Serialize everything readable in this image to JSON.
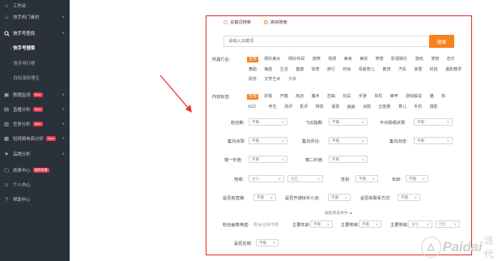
{
  "sidebar": {
    "items": [
      {
        "icon": "home-icon",
        "label": "工作台"
      },
      {
        "icon": "fire-icon",
        "label": "快手热门素材",
        "caret": "∨"
      },
      {
        "icon": "search-icon",
        "label": "快手号查找",
        "caret": "∧"
      },
      {
        "label": "· 快手号搜索"
      },
      {
        "label": "· 快手排行榜"
      },
      {
        "label": "· 目标涨粉博主"
      },
      {
        "icon": "monitor-icon",
        "label": "数据监测",
        "badge": "New",
        "caret": "∨"
      },
      {
        "icon": "live-icon",
        "label": "直播分析",
        "badge": "New",
        "caret": "∨"
      },
      {
        "icon": "task-icon",
        "label": "任务分析",
        "badge": "New",
        "caret": "∨"
      },
      {
        "icon": "video-icon",
        "label": "短视频电商分析",
        "badge": "New",
        "caret": "∨"
      },
      {
        "icon": "heart-icon",
        "label": "品牌分析",
        "caret": "∨"
      },
      {
        "icon": "member-icon",
        "label": "续费中心",
        "badge": "限时特惠"
      },
      {
        "icon": "user-icon",
        "label": "个人中心"
      },
      {
        "icon": "help-icon",
        "label": "帮助中心"
      }
    ]
  },
  "search": {
    "mode_keyword": "关键词搜索",
    "mode_advanced": "高级搜索",
    "placeholder": "请输入关键词",
    "button": "搜索"
  },
  "filters": {
    "industry_label": "所属行业:",
    "industry_tags": [
      "全部",
      "网红美女",
      "网红帅哥",
      "搞笑",
      "情感",
      "美食",
      "美妆",
      "穿搭",
      "影视娱乐",
      "游戏",
      "宠物",
      "音乐",
      "舞蹈",
      "萌娃",
      "生活",
      "健康",
      "体育",
      "旅行",
      "时尚",
      "母婴育儿",
      "教育",
      "汽车",
      "家居",
      "科技",
      "摄影教学",
      "政务",
      "文学艺术",
      "户外"
    ],
    "content_label": "内容标签:",
    "content_tags": [
      "全部",
      "护肤",
      "开箱",
      "房店",
      "魔术",
      "恋曲",
      "玩具",
      "手游",
      "单机",
      "美甲",
      "游戏解说",
      "猫",
      "狗",
      "K12",
      "养生",
      "测评",
      "影评",
      "特效",
      "语录",
      "画画",
      "涂鸦",
      "正能量",
      "育儿",
      "手机",
      "摄影"
    ],
    "rows": {
      "fans_label": "粉丝数:",
      "growth_label": "飞瓜指数:",
      "avg_video_likes_label": "平均视频点赞:",
      "avg_likes_label": "集均点赞:",
      "avg_comments_label": "集均评论:",
      "avg_views_label": "集均浏览:",
      "price_label": "楼一价值:",
      "price2_label": "楼二价值:",
      "region_label": "地域:",
      "gender_label": "性别:",
      "age_label": "年龄:",
      "live_label": "是否有直播:",
      "shop_label": "是否开通快手小店:",
      "contact_label": "是否有联系方式:",
      "fans_profile_label": "粉丝画像筛选:",
      "fans_gender_label": "男女比例不限",
      "main_age_label": "主要年龄:",
      "main_region_label": "主要地域:",
      "verified_label": "是否往绩:"
    },
    "any": "不限",
    "province_ph": "省份",
    "city_ph": "地区",
    "collapse": "收起筛选条件 ▲"
  },
  "watermark": {
    "brand": "Paidai",
    "cn": "派代"
  },
  "colors": {
    "accent": "#f5821f",
    "sidebar_bg": "#2b313b",
    "highlight_border": "#e12b2b"
  }
}
